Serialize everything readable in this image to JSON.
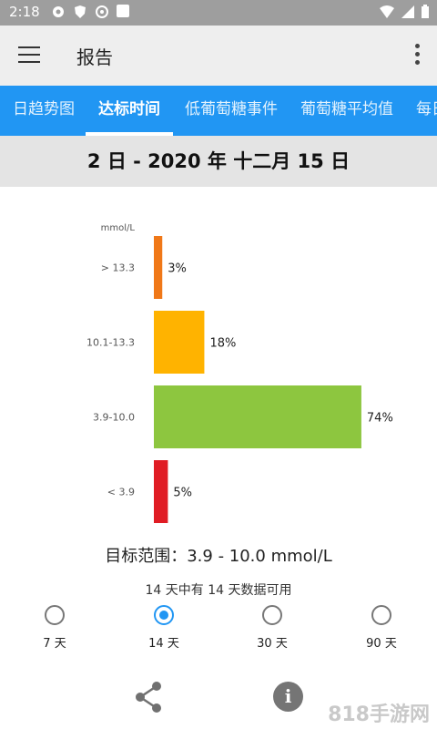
{
  "status": {
    "time": "2:18"
  },
  "appbar": {
    "title": "报告"
  },
  "tabs": [
    {
      "label": "日趋势图",
      "active": false
    },
    {
      "label": "达标时间",
      "active": true
    },
    {
      "label": "低葡萄糖事件",
      "active": false
    },
    {
      "label": "葡萄糖平均值",
      "active": false
    },
    {
      "label": "每日",
      "active": false
    }
  ],
  "date_range": "2 日 - 2020 年 十二月 15 日",
  "chart_data": {
    "type": "bar",
    "orientation": "horizontal",
    "unit_label": "mmol/L",
    "categories": [
      "> 13.3",
      "10.1-13.3",
      "3.9-10.0",
      "< 3.9"
    ],
    "values": [
      3,
      18,
      74,
      5
    ],
    "value_labels": [
      "3%",
      "18%",
      "74%",
      "5%"
    ],
    "colors": [
      "#f07818",
      "#ffb300",
      "#8dc63f",
      "#e01c24"
    ],
    "xlim": [
      0,
      100
    ]
  },
  "target_range": "目标范围：3.9 - 10.0 mmol/L",
  "data_availability": "14 天中有 14 天数据可用",
  "period_options": [
    {
      "label": "7 天",
      "selected": false
    },
    {
      "label": "14 天",
      "selected": true
    },
    {
      "label": "30 天",
      "selected": false
    },
    {
      "label": "90 天",
      "selected": false
    }
  ],
  "watermark": "818手游网"
}
